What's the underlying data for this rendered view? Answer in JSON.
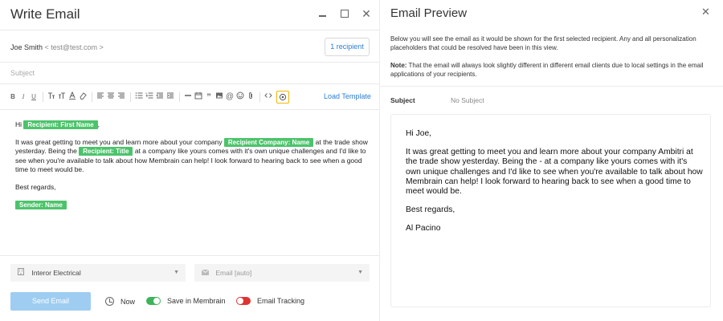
{
  "compose": {
    "title": "Write Email",
    "window_controls": {
      "minimize": "",
      "maximize": "",
      "close": "✕"
    },
    "from_name": "Joe Smith",
    "from_email": "< test@test.com >",
    "recipient_button": "1 recipient",
    "subject_placeholder": "Subject",
    "toolbar": {
      "bold": "B",
      "italic": "I",
      "underline": "U",
      "load_template": "Load Template"
    },
    "body": {
      "greeting": "Hi",
      "tag_first_name": "Recipient: First Name",
      "greeting_end": ",",
      "para1_a": "It was great getting to meet you and learn more about your company",
      "tag_company": "Recipient Company: Name",
      "para1_b": "at the trade show yesterday. Being the",
      "tag_title": "Recipient: Title",
      "para1_c": "at a company like yours comes with it's own unique challenges and I'd like to see when you're available to talk about how Membrain can help! I look forward to hearing back to see when a good time to meet would be.",
      "closing": "Best regards,",
      "tag_sender": "Sender: Name"
    },
    "company_select": "Interor Electrical",
    "email_select_placeholder": "Email [auto]",
    "send_button": "Send Email",
    "now_label": "Now",
    "save_label": "Save in Membrain",
    "save_toggle": true,
    "tracking_label": "Email Tracking",
    "tracking_toggle": false,
    "colors": {
      "tag": "#4cc36b",
      "link": "#2a7ed3",
      "send": "#9ecdf1",
      "toggle_on": "#3cb45a",
      "toggle_off": "#e03434",
      "preview_highlight": "#f2b600"
    }
  },
  "preview": {
    "title": "Email Preview",
    "close": "✕",
    "description": "Below you will see the email as it would be shown for the first selected recipient. Any and all personalization placeholders that could be resolved have been in this view.",
    "note_label": "Note:",
    "note_text": "That the email will always look slightly different in different email clients due to local settings in the email applications of your recipients.",
    "subject_label": "Subject",
    "subject_value": "No Subject",
    "body": {
      "greeting": "Hi Joe,",
      "para1": "It was great getting to meet you and learn more about your company Ambitri at the trade show yesterday. Being the - at a company like yours comes with it's own unique challenges and I'd like to see when you're available to talk about how Membrain can help! I look forward to hearing back to see when a good time to meet would be.",
      "closing": "Best regards,",
      "signature": "Al Pacino"
    }
  }
}
